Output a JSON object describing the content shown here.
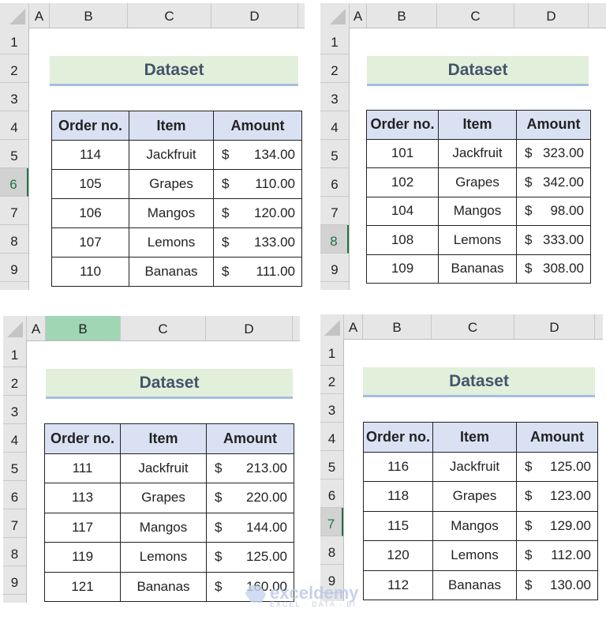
{
  "sheets": [
    {
      "columns": [
        "A",
        "B",
        "C",
        "D"
      ],
      "rows": [
        "1",
        "2",
        "3",
        "4",
        "5",
        "6",
        "7",
        "8",
        "9"
      ],
      "selected_row": "6",
      "selected_col": null,
      "title": "Dataset",
      "headers": [
        "Order no.",
        "Item",
        "Amount"
      ],
      "records": [
        {
          "order": "114",
          "item": "Jackfruit",
          "currency": "$",
          "amount": "134.00"
        },
        {
          "order": "105",
          "item": "Grapes",
          "currency": "$",
          "amount": "110.00"
        },
        {
          "order": "106",
          "item": "Mangos",
          "currency": "$",
          "amount": "120.00"
        },
        {
          "order": "107",
          "item": "Lemons",
          "currency": "$",
          "amount": "133.00"
        },
        {
          "order": "110",
          "item": "Bananas",
          "currency": "$",
          "amount": "111.00"
        }
      ]
    },
    {
      "columns": [
        "A",
        "B",
        "C",
        "D"
      ],
      "rows": [
        "1",
        "2",
        "3",
        "4",
        "5",
        "6",
        "7",
        "8",
        "9"
      ],
      "selected_row": "8",
      "selected_col": null,
      "title": "Dataset",
      "headers": [
        "Order no.",
        "Item",
        "Amount"
      ],
      "records": [
        {
          "order": "101",
          "item": "Jackfruit",
          "currency": "$",
          "amount": "323.00"
        },
        {
          "order": "102",
          "item": "Grapes",
          "currency": "$",
          "amount": "342.00"
        },
        {
          "order": "104",
          "item": "Mangos",
          "currency": "$",
          "amount": "98.00"
        },
        {
          "order": "108",
          "item": "Lemons",
          "currency": "$",
          "amount": "333.00"
        },
        {
          "order": "109",
          "item": "Bananas",
          "currency": "$",
          "amount": "308.00"
        }
      ]
    },
    {
      "columns": [
        "A",
        "B",
        "C",
        "D"
      ],
      "rows": [
        "1",
        "2",
        "3",
        "4",
        "5",
        "6",
        "7",
        "8",
        "9"
      ],
      "selected_row": null,
      "selected_col": "B",
      "title": "Dataset",
      "headers": [
        "Order no.",
        "Item",
        "Amount"
      ],
      "records": [
        {
          "order": "111",
          "item": "Jackfruit",
          "currency": "$",
          "amount": "213.00"
        },
        {
          "order": "113",
          "item": "Grapes",
          "currency": "$",
          "amount": "220.00"
        },
        {
          "order": "117",
          "item": "Mangos",
          "currency": "$",
          "amount": "144.00"
        },
        {
          "order": "119",
          "item": "Lemons",
          "currency": "$",
          "amount": "125.00"
        },
        {
          "order": "121",
          "item": "Bananas",
          "currency": "$",
          "amount": "160.00"
        }
      ]
    },
    {
      "columns": [
        "A",
        "B",
        "C",
        "D"
      ],
      "rows": [
        "1",
        "2",
        "3",
        "4",
        "5",
        "6",
        "7",
        "8",
        "9"
      ],
      "selected_row": "7",
      "selected_col": null,
      "title": "Dataset",
      "headers": [
        "Order no.",
        "Item",
        "Amount"
      ],
      "records": [
        {
          "order": "116",
          "item": "Jackfruit",
          "currency": "$",
          "amount": "125.00"
        },
        {
          "order": "118",
          "item": "Grapes",
          "currency": "$",
          "amount": "123.00"
        },
        {
          "order": "115",
          "item": "Mangos",
          "currency": "$",
          "amount": "129.00"
        },
        {
          "order": "120",
          "item": "Lemons",
          "currency": "$",
          "amount": "112.00"
        },
        {
          "order": "112",
          "item": "Bananas",
          "currency": "$",
          "amount": "130.00"
        }
      ]
    }
  ],
  "watermark": {
    "brand": "exceldemy",
    "tagline": "EXCEL · DATA · BI"
  },
  "colors": {
    "title_fill": "#e2efda",
    "title_text": "#44546a",
    "header_fill": "#d9e1f2",
    "selected_col": "#a0d6b4",
    "selection_accent": "#217346"
  }
}
